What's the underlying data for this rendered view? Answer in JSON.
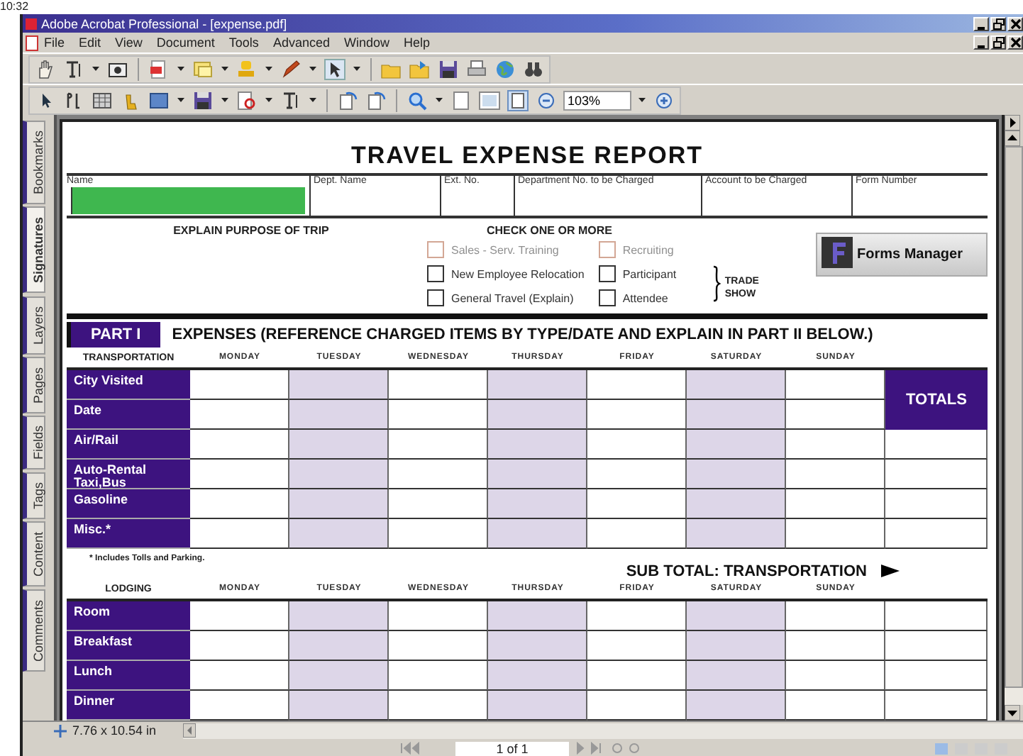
{
  "background": {
    "clock": "10:32"
  },
  "window": {
    "title": "Adobe Acrobat Professional - [expense.pdf]"
  },
  "menu": [
    "File",
    "Edit",
    "View",
    "Document",
    "Tools",
    "Advanced",
    "Window",
    "Help"
  ],
  "toolbar": {
    "zoom": "103%"
  },
  "nav_tabs": [
    {
      "label": "Bookmarks",
      "selected": false
    },
    {
      "label": "Signatures",
      "selected": true
    },
    {
      "label": "Layers",
      "selected": false
    },
    {
      "label": "Pages",
      "selected": false
    },
    {
      "label": "Fields",
      "selected": false
    },
    {
      "label": "Tags",
      "selected": false
    },
    {
      "label": "Content",
      "selected": false
    },
    {
      "label": "Comments",
      "selected": false
    }
  ],
  "form": {
    "title": "TRAVEL EXPENSE REPORT",
    "header_fields": [
      {
        "label": "Name",
        "focused": true
      },
      {
        "label": "Dept. Name",
        "focused": false
      },
      {
        "label": "Ext. No.",
        "focused": false
      },
      {
        "label": "Department No. to be Charged",
        "focused": false
      },
      {
        "label": "Account to be Charged",
        "focused": false
      },
      {
        "label": "Form Number",
        "focused": false
      }
    ],
    "purpose_label": "EXPLAIN PURPOSE OF TRIP",
    "check_label": "CHECK ONE OR MORE",
    "options": [
      {
        "label": "Sales - Serv. Training",
        "checked": false,
        "highlighted": true
      },
      {
        "label": "Recruiting",
        "checked": false,
        "highlighted": true
      },
      {
        "label": "New Employee Relocation",
        "checked": false,
        "highlighted": false
      },
      {
        "label": "Participant",
        "checked": false,
        "highlighted": false
      },
      {
        "label": "General Travel (Explain)",
        "checked": false,
        "highlighted": false
      },
      {
        "label": "Attendee",
        "checked": false,
        "highlighted": false
      }
    ],
    "trade_show": "TRADE SHOW",
    "forms_manager": "Forms Manager",
    "part": {
      "badge": "PART I",
      "heading": "EXPENSES (REFERENCE CHARGED ITEMS BY TYPE/DATE AND EXPLAIN IN PART II BELOW.)"
    },
    "transportation": {
      "heading": "TRANSPORTATION",
      "days": [
        "MONDAY",
        "TUESDAY",
        "WEDNESDAY",
        "THURSDAY",
        "FRIDAY",
        "SATURDAY",
        "SUNDAY"
      ],
      "rows": [
        "City Visited",
        "Date",
        "Air/Rail",
        "Auto-Rental\nTaxi,Bus",
        "Gasoline",
        "Misc.*"
      ],
      "totals": "TOTALS",
      "footnote": "* Includes Tolls and Parking.",
      "subtotal": "SUB TOTAL: TRANSPORTATION"
    },
    "lodging": {
      "heading": "LODGING",
      "days": [
        "MONDAY",
        "TUESDAY",
        "WEDNESDAY",
        "THURSDAY",
        "FRIDAY",
        "SATURDAY",
        "SUNDAY"
      ],
      "rows": [
        "Room",
        "Breakfast",
        "Lunch",
        "Dinner"
      ]
    }
  },
  "status": {
    "page_size": "7.76 x 10.54 in",
    "page": "1 of 1"
  }
}
